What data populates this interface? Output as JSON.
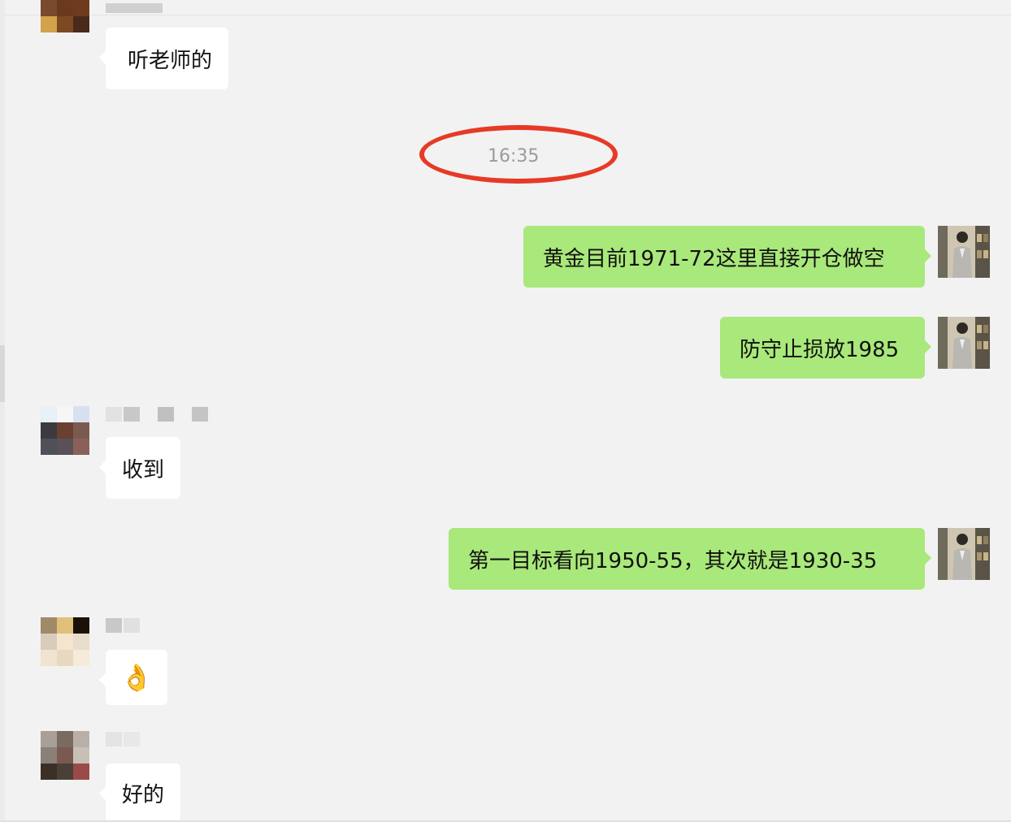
{
  "messages": [
    {
      "id": "m1",
      "side": "left",
      "text": "听老师的"
    },
    {
      "id": "m2",
      "side": "right",
      "text": "黄金目前1971-72这里直接开仓做空"
    },
    {
      "id": "m3",
      "side": "right",
      "text": "防守止损放1985"
    },
    {
      "id": "m4",
      "side": "left",
      "text": "收到"
    },
    {
      "id": "m5",
      "side": "right",
      "text": "第一目标看向1950-55，其次就是1930-35"
    },
    {
      "id": "m6",
      "side": "left",
      "text": "👌"
    },
    {
      "id": "m7",
      "side": "left",
      "text": "好的"
    }
  ],
  "timestamp": "16:35",
  "colors": {
    "sent_bubble": "#a9e87a",
    "received_bubble": "#ffffff",
    "background": "#f2f2f2",
    "annotation_ring": "#e63a26"
  }
}
